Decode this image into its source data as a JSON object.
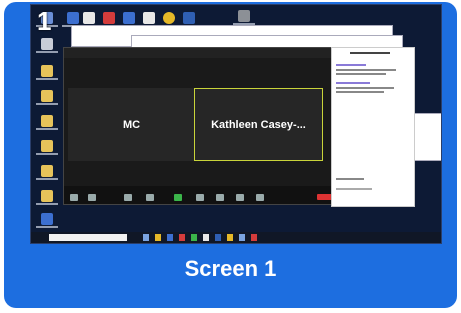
{
  "card": {
    "number": "1",
    "label": "Screen 1",
    "accent_color": "#1d6ee0"
  },
  "zoom": {
    "participants": [
      {
        "name": "MC"
      },
      {
        "name": "Kathleen  Casey-..."
      }
    ]
  }
}
